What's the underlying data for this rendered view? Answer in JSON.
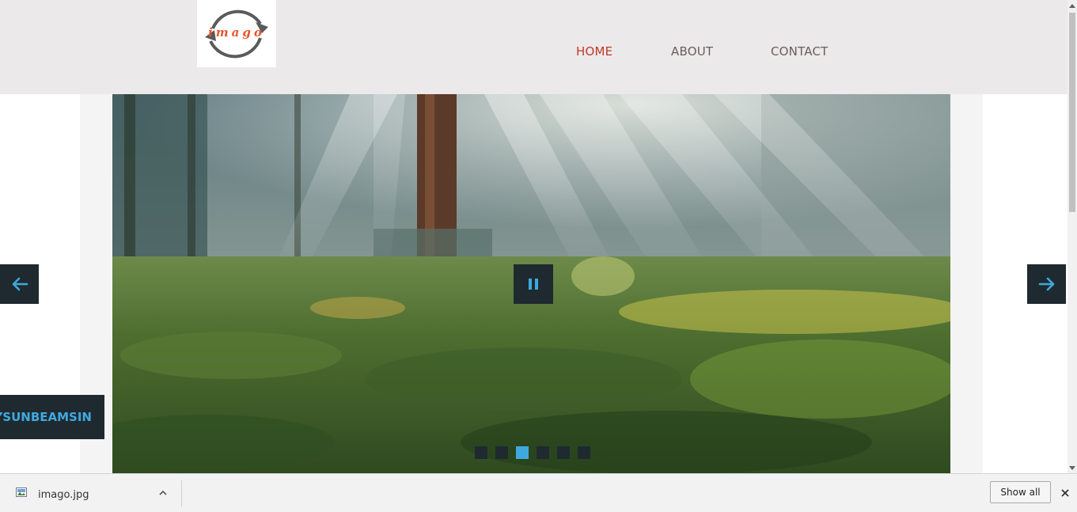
{
  "header": {
    "logo_text": "imago",
    "nav": [
      {
        "label": "HOME",
        "active": true
      },
      {
        "label": "ABOUT",
        "active": false
      },
      {
        "label": "CONTACT",
        "active": false
      }
    ]
  },
  "slider": {
    "caption": "YSUNBEAMSIN",
    "slide_count": 6,
    "active_slide_index": 2,
    "icons": {
      "prev": "arrow-left-icon",
      "next": "arrow-right-icon",
      "pause": "pause-icon"
    }
  },
  "download_bar": {
    "file_name": "imago.jpg",
    "show_all_label": "Show all",
    "icons": {
      "file": "image-file-icon",
      "menu": "chevron-up-icon",
      "close": "close-icon"
    }
  },
  "colors": {
    "header_bg": "#ebe9e9",
    "nav_active": "#c0392b",
    "nav_default": "#6b5d5d",
    "control_bg": "#1e2a30",
    "accent": "#3fa9de"
  }
}
